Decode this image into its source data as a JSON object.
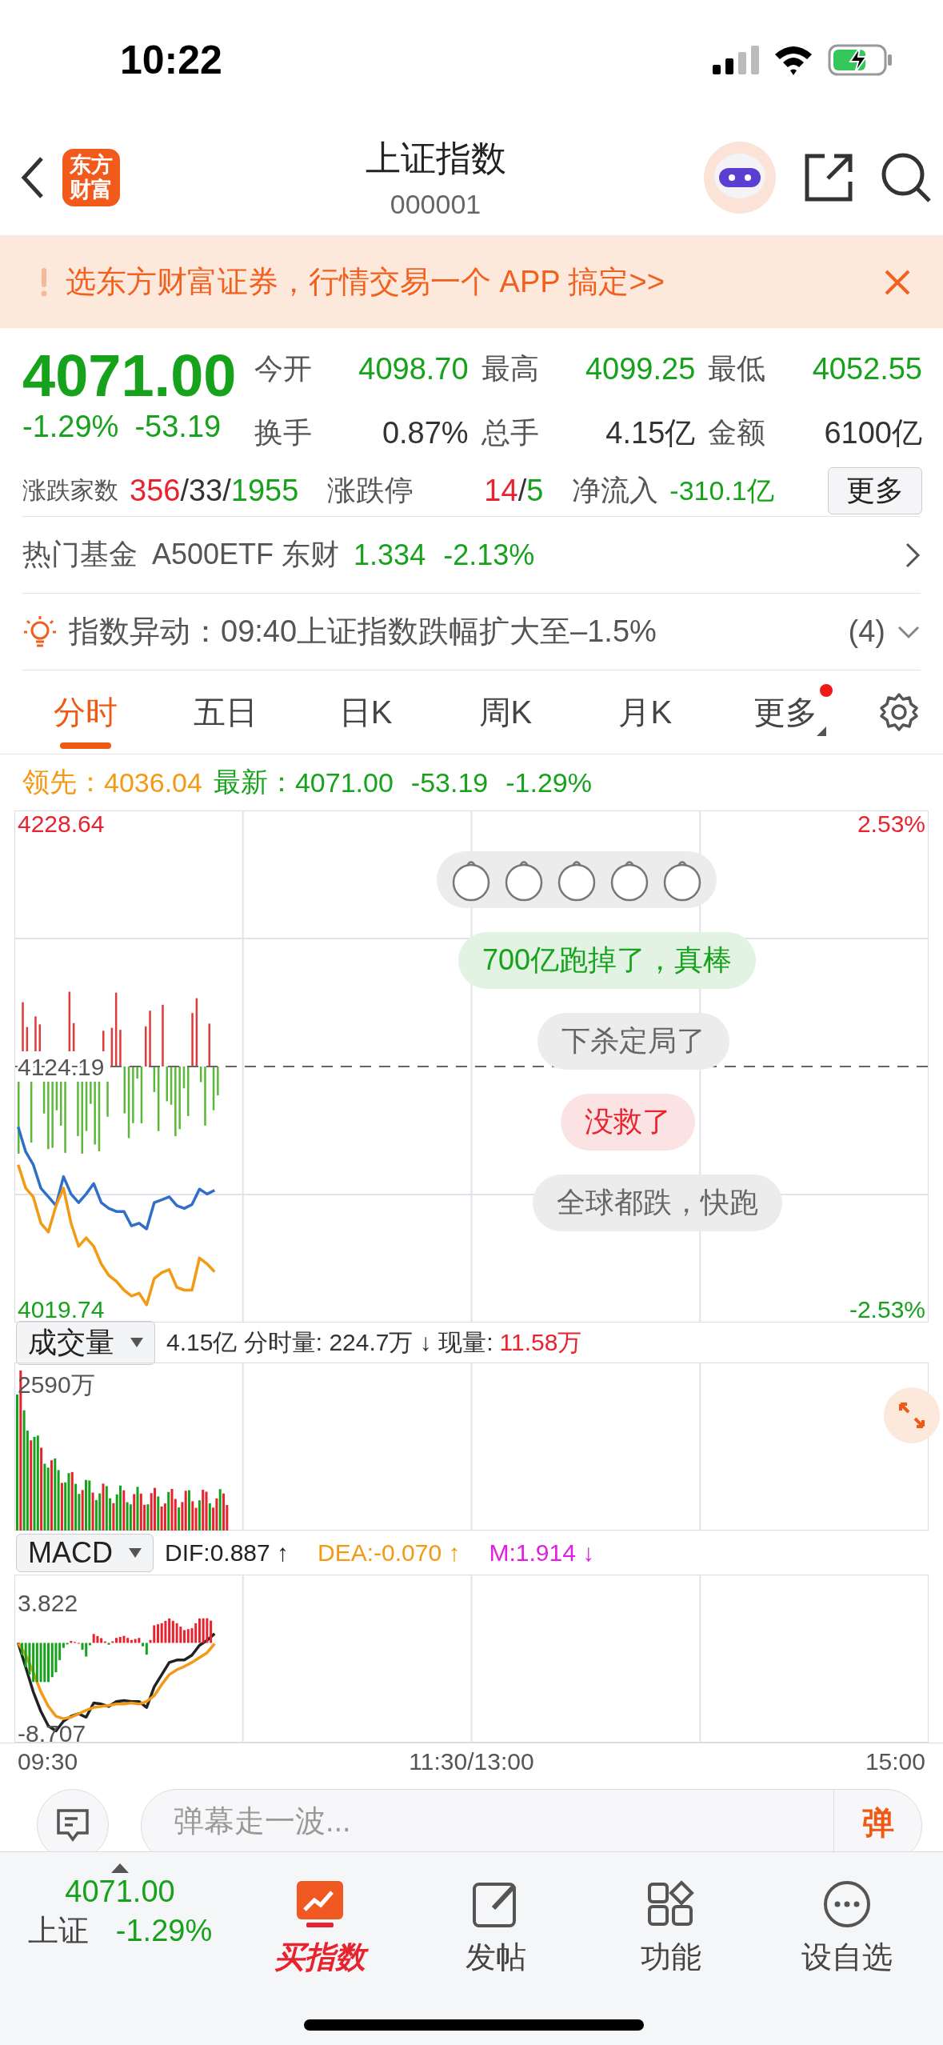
{
  "status_bar": {
    "time": "10:22"
  },
  "header": {
    "logo_text": "东方财富",
    "title": "上证指数",
    "code": "000001"
  },
  "banner": {
    "text": "选东方财富证券，行情交易一个 APP 搞定>>"
  },
  "quote": {
    "price": "4071.00",
    "change_pct": "-1.29%",
    "change": "-53.19",
    "color": "#17a21c",
    "stats": [
      {
        "label": "今开",
        "value": "4098.70",
        "color": "#17a21c"
      },
      {
        "label": "最高",
        "value": "4099.25",
        "color": "#17a21c"
      },
      {
        "label": "最低",
        "value": "4052.55",
        "color": "#17a21c"
      },
      {
        "label": "换手",
        "value": "0.87%",
        "color": "#333333"
      },
      {
        "label": "总手",
        "value": "4.15亿",
        "color": "#333333"
      },
      {
        "label": "金额",
        "value": "6100亿",
        "color": "#333333"
      }
    ],
    "breadth": {
      "label": "涨跌家数",
      "parts": [
        {
          "text": "356",
          "color": "#e8232f"
        },
        {
          "text": "/33/",
          "color": "#333333"
        },
        {
          "text": "1955",
          "color": "#17a21c"
        }
      ]
    },
    "limit": {
      "label": "涨跌停",
      "parts": [
        {
          "text": "14",
          "color": "#e8232f"
        },
        {
          "text": "/",
          "color": "#333333"
        },
        {
          "text": "5",
          "color": "#17a21c"
        }
      ]
    },
    "net_inflow": {
      "label": "净流入",
      "value": "-310.1亿",
      "color": "#17a21c"
    },
    "more_button": "更多"
  },
  "hot_fund": {
    "label": "热门基金",
    "name": "A500ETF 东财",
    "price": "1.334",
    "change": "-2.13%",
    "color": "#17a21c"
  },
  "alert": {
    "text": "指数异动：09:40上证指数跌幅扩大至–1.5%",
    "count": "(4)"
  },
  "tabs": [
    {
      "label": "分时",
      "selected": true,
      "badge": false,
      "dropdown": false
    },
    {
      "label": "五日",
      "selected": false,
      "badge": false,
      "dropdown": false
    },
    {
      "label": "日K",
      "selected": false,
      "badge": false,
      "dropdown": false
    },
    {
      "label": "周K",
      "selected": false,
      "badge": false,
      "dropdown": false
    },
    {
      "label": "月K",
      "selected": false,
      "badge": false,
      "dropdown": false
    },
    {
      "label": "更多",
      "selected": false,
      "badge": true,
      "dropdown": true
    }
  ],
  "legend": {
    "lead_label": "领先：",
    "lead_value": "4036.04",
    "last_label": "最新：",
    "last_value": "4071.00",
    "change": "-53.19",
    "change_pct": "-1.29%"
  },
  "intraday_chart": {
    "chart_data": {
      "type": "line",
      "ylim": [
        4014.19,
        4234.19
      ],
      "yticks": [
        {
          "value": 4228.64,
          "label": "4228.64"
        },
        {
          "value": 4124.19,
          "label": "4124.19"
        },
        {
          "value": 4019.74,
          "label": "4019.74"
        }
      ],
      "categories": [
        null,
        null,
        null,
        null,
        null,
        null,
        null,
        null,
        null,
        null,
        null,
        null,
        null,
        null,
        null,
        null,
        null,
        null,
        null,
        null,
        null,
        null,
        null,
        null,
        null,
        null,
        null,
        null,
        null,
        null,
        null,
        null,
        null,
        null,
        null,
        null,
        null,
        null,
        null,
        null,
        null,
        null,
        null,
        null,
        null,
        null,
        null,
        null,
        null,
        null,
        null,
        null,
        null,
        null,
        null,
        null,
        null,
        null,
        null,
        null,
        null,
        null,
        null,
        null,
        null,
        null,
        null,
        null,
        null,
        null,
        null,
        null,
        null,
        null,
        null,
        null,
        null,
        null,
        null,
        null,
        null,
        null,
        null,
        null,
        null,
        null,
        null,
        null,
        null,
        null,
        null,
        null,
        null,
        null,
        null,
        null,
        null,
        null,
        null,
        null,
        null,
        null,
        null,
        null,
        null,
        null,
        null,
        null,
        null,
        null,
        null,
        null,
        null,
        null,
        null,
        null,
        null,
        null,
        null,
        null,
        null
      ],
      "series": [
        {
          "color": "#2f6fc7",
          "values": [
            4098.2,
            4087.5,
            4082.0,
            4071.9,
            4068.2,
            4064.4,
            4076.9,
            4069.4,
            4065.7,
            4069.4,
            4073.9,
            4065.7,
            4063.2,
            4061.9,
            4061.9,
            4055.7,
            4056.9,
            4054.4,
            4065.7,
            4066.9,
            4068.2,
            4064.4,
            4063.2,
            4064.9,
            4071.5,
            4069.4,
            4071.0,
            null,
            null,
            null,
            null,
            null,
            null,
            null,
            null,
            null,
            null,
            null,
            null,
            null,
            null,
            null,
            null,
            null,
            null,
            null,
            null,
            null,
            null,
            null,
            null,
            null,
            null,
            null,
            null,
            null,
            null,
            null,
            null,
            null,
            null,
            null,
            null,
            null,
            null,
            null,
            null,
            null,
            null,
            null,
            null,
            null,
            null,
            null,
            null,
            null,
            null,
            null,
            null,
            null,
            null,
            null,
            null,
            null,
            null,
            null,
            null,
            null,
            null,
            null,
            null,
            null,
            null,
            null,
            null,
            null,
            null,
            null,
            null,
            null,
            null,
            null,
            null,
            null,
            null,
            null,
            null,
            null,
            null,
            null,
            null,
            null,
            null,
            null,
            null,
            null,
            null,
            null,
            null,
            null,
            null
          ]
        },
        {
          "color": "#f39a14",
          "values": [
            4082.0,
            4071.9,
            4068.2,
            4056.9,
            4053.1,
            4064.4,
            4071.9,
            4056.9,
            4046.9,
            4050.6,
            4046.9,
            4039.4,
            4034.4,
            4031.9,
            4028.1,
            4025.6,
            4026.8,
            4021.8,
            4033.1,
            4035.6,
            4036.9,
            4029.3,
            4028.1,
            4028.1,
            4041.9,
            4039.4,
            4036.0,
            null,
            null,
            null,
            null,
            null,
            null,
            null,
            null,
            null,
            null,
            null,
            null,
            null,
            null,
            null,
            null,
            null,
            null,
            null,
            null,
            null,
            null,
            null,
            null,
            null,
            null,
            null,
            null,
            null,
            null,
            null,
            null,
            null,
            null,
            null,
            null,
            null,
            null,
            null,
            null,
            null,
            null,
            null,
            null,
            null,
            null,
            null,
            null,
            null,
            null,
            null,
            null,
            null,
            null,
            null,
            null,
            null,
            null,
            null,
            null,
            null,
            null,
            null,
            null,
            null,
            null,
            null,
            null,
            null,
            null,
            null,
            null,
            null,
            null,
            null,
            null,
            null,
            null,
            null,
            null,
            null,
            null,
            null,
            null,
            null,
            null,
            null,
            null,
            null,
            null,
            null,
            null,
            null,
            null
          ]
        }
      ]
    },
    "right_ticks": [
      "2.53%",
      "-2.53%"
    ],
    "danmaku": [
      {
        "kind": "emoji"
      },
      {
        "kind": "positive",
        "text": "700亿跑掉了，真棒"
      },
      {
        "kind": "neutral",
        "text": "下杀定局了"
      },
      {
        "kind": "negative",
        "text": "没救了"
      },
      {
        "kind": "neutral",
        "text": "全球都跌，快跑"
      }
    ]
  },
  "volume_chart": {
    "selector": "成交量",
    "summary": "4.15亿 分时量: 224.7万 ↓ 现量:",
    "current": "11.58万",
    "max_label": "2590万"
  },
  "macd_chart": {
    "selector": "MACD",
    "legend": [
      {
        "text": "DIF:0.887 ↑",
        "color": "#222222"
      },
      {
        "text": "DEA:-0.070 ↑",
        "color": "#f39a14"
      },
      {
        "text": "M:1.914 ↓",
        "color": "#e020e0"
      }
    ],
    "chart_data": {
      "type": "line",
      "ylim": [
        -9.635,
        6.606
      ],
      "yticks": [
        {
          "value": 3.822,
          "label": "3.822"
        },
        {
          "value": -8.707,
          "label": "-8.707"
        }
      ],
      "categories": [
        null,
        null,
        null,
        null,
        null,
        null,
        null,
        null,
        null,
        null,
        null,
        null,
        null,
        null,
        null,
        null,
        null,
        null,
        null,
        null,
        null,
        null,
        null,
        null,
        null,
        null,
        null,
        null,
        null,
        null,
        null,
        null,
        null,
        null,
        null,
        null,
        null,
        null,
        null,
        null,
        null,
        null,
        null,
        null,
        null,
        null,
        null,
        null,
        null,
        null,
        null,
        null,
        null,
        null,
        null,
        null,
        null,
        null,
        null,
        null,
        null,
        null,
        null,
        null,
        null,
        null,
        null,
        null,
        null,
        null,
        null,
        null,
        null,
        null,
        null,
        null,
        null,
        null,
        null,
        null,
        null,
        null,
        null,
        null,
        null,
        null,
        null,
        null,
        null,
        null,
        null,
        null,
        null,
        null,
        null,
        null,
        null,
        null,
        null,
        null,
        null,
        null,
        null,
        null,
        null,
        null,
        null,
        null,
        null,
        null,
        null,
        null,
        null,
        null,
        null,
        null,
        null,
        null,
        null,
        null,
        null
      ],
      "series": [
        {
          "color": "#222222",
          "values": [
            0,
            -2.36,
            -4.73,
            -6.62,
            -8.03,
            -8.51,
            -7.56,
            -7.09,
            -6.85,
            -7.18,
            -5.81,
            -5.91,
            -6.14,
            -5.67,
            -5.57,
            -5.67,
            -5.67,
            -6.24,
            -4.25,
            -3.07,
            -1.89,
            -1.65,
            -1.65,
            -1.18,
            -0.24,
            0.24,
            0.89,
            null,
            null,
            null,
            null,
            null,
            null,
            null,
            null,
            null,
            null,
            null,
            null,
            null,
            null,
            null,
            null,
            null,
            null,
            null,
            null,
            null,
            null,
            null,
            null,
            null,
            null,
            null,
            null,
            null,
            null,
            null,
            null,
            null,
            null,
            null,
            null,
            null,
            null,
            null,
            null,
            null,
            null,
            null,
            null,
            null,
            null,
            null,
            null,
            null,
            null,
            null,
            null,
            null,
            null,
            null,
            null,
            null,
            null,
            null,
            null,
            null,
            null,
            null,
            null,
            null,
            null,
            null,
            null,
            null,
            null,
            null,
            null,
            null,
            null,
            null,
            null,
            null,
            null,
            null,
            null,
            null,
            null,
            null,
            null,
            null,
            null,
            null,
            null,
            null,
            null,
            null,
            null,
            null,
            null
          ]
        },
        {
          "color": "#f39a14",
          "values": [
            0,
            -1.18,
            -2.84,
            -4.73,
            -6.14,
            -7.09,
            -7.32,
            -7.18,
            -6.85,
            -6.52,
            -6.24,
            -6.14,
            -6.05,
            -5.91,
            -5.91,
            -5.81,
            -5.91,
            -5.67,
            -5.1,
            -4.02,
            -3.07,
            -2.6,
            -2.27,
            -1.89,
            -1.42,
            -0.95,
            -0.07,
            null,
            null,
            null,
            null,
            null,
            null,
            null,
            null,
            null,
            null,
            null,
            null,
            null,
            null,
            null,
            null,
            null,
            null,
            null,
            null,
            null,
            null,
            null,
            null,
            null,
            null,
            null,
            null,
            null,
            null,
            null,
            null,
            null,
            null,
            null,
            null,
            null,
            null,
            null,
            null,
            null,
            null,
            null,
            null,
            null,
            null,
            null,
            null,
            null,
            null,
            null,
            null,
            null,
            null,
            null,
            null,
            null,
            null,
            null,
            null,
            null,
            null,
            null,
            null,
            null,
            null,
            null,
            null,
            null,
            null,
            null,
            null,
            null,
            null,
            null,
            null,
            null,
            null,
            null,
            null,
            null,
            null,
            null,
            null,
            null,
            null,
            null,
            null,
            null,
            null,
            null,
            null,
            null,
            null
          ]
        }
      ]
    }
  },
  "time_axis": [
    "09:30",
    "11:30/13:00",
    "15:00"
  ],
  "danmaku_bar": {
    "placeholder": "弹幕走一波...",
    "send": "弹"
  },
  "bottom_bar": {
    "quote": {
      "price": "4071.00",
      "name": "上证",
      "change_pct": "-1.29%",
      "color": "#17a21c"
    },
    "items": [
      {
        "kind": "promo",
        "label": "买指数"
      },
      {
        "kind": "post",
        "label": "发帖"
      },
      {
        "kind": "tools",
        "label": "功能"
      },
      {
        "kind": "watch",
        "label": "设自选"
      }
    ]
  }
}
